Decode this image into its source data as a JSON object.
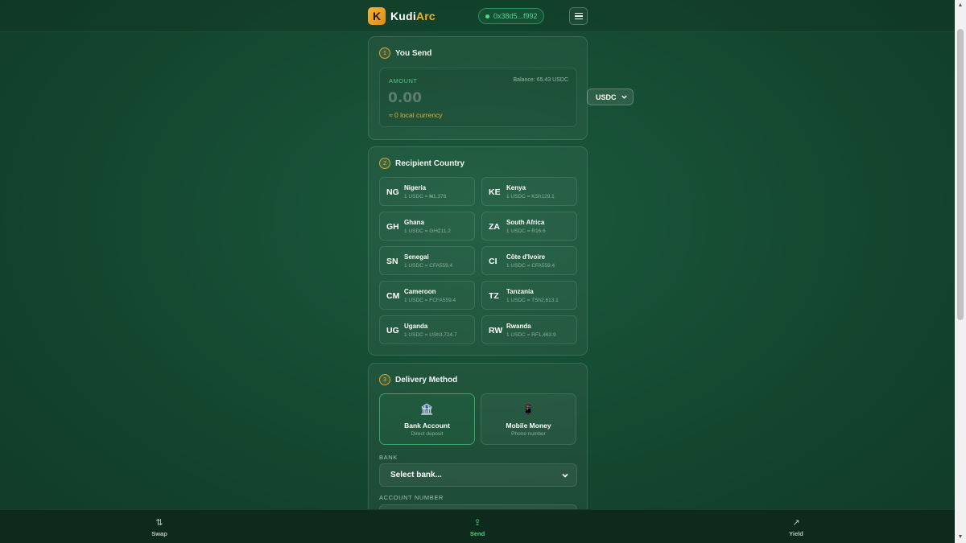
{
  "header": {
    "logo_letter": "K",
    "logo_text_a": "Kudi",
    "logo_text_b": "Arc",
    "wallet_address": "0x38d5...f992",
    "menu_icon": "hamburger-icon"
  },
  "send_section": {
    "step": "1",
    "title": "You Send",
    "amount_label": "AMOUNT",
    "balance": "Balance: 65.43 USDC",
    "amount_placeholder": "0.00",
    "local_estimate": "≈ 0 local currency",
    "currency": "USDC"
  },
  "country_section": {
    "step": "2",
    "title": "Recipient Country",
    "countries": [
      {
        "code": "NG",
        "name": "Nigeria",
        "rate": "1 USDC = ₦1,376"
      },
      {
        "code": "KE",
        "name": "Kenya",
        "rate": "1 USDC = KSh129.1"
      },
      {
        "code": "GH",
        "name": "Ghana",
        "rate": "1 USDC = GH₵11.2"
      },
      {
        "code": "ZA",
        "name": "South Africa",
        "rate": "1 USDC = R16.6"
      },
      {
        "code": "SN",
        "name": "Senegal",
        "rate": "1 USDC = CFA559.4"
      },
      {
        "code": "CI",
        "name": "Côte d'Ivoire",
        "rate": "1 USDC = CFA559.4"
      },
      {
        "code": "CM",
        "name": "Cameroon",
        "rate": "1 USDC = FCFA559.4"
      },
      {
        "code": "TZ",
        "name": "Tanzania",
        "rate": "1 USDC = TSh2,613.1"
      },
      {
        "code": "UG",
        "name": "Uganda",
        "rate": "1 USDC = USh3,724.7"
      },
      {
        "code": "RW",
        "name": "Rwanda",
        "rate": "1 USDC = RF1,463.9"
      }
    ]
  },
  "delivery_section": {
    "step": "3",
    "title": "Delivery Method",
    "methods": [
      {
        "name": "Bank Account",
        "sub": "Direct deposit",
        "icon": "bank-icon",
        "glyph": "🏦",
        "selected": true
      },
      {
        "name": "Mobile Money",
        "sub": "Phone number",
        "icon": "phone-icon",
        "glyph": "📱",
        "selected": false
      }
    ],
    "bank_label": "BANK",
    "bank_select_value": "Select bank...",
    "account_label": "ACCOUNT NUMBER"
  },
  "bottom_nav": [
    {
      "label": "Swap",
      "icon": "swap-icon",
      "glyph": "⇅",
      "active": false
    },
    {
      "label": "Send",
      "icon": "send-icon",
      "glyph": "⇪",
      "active": true
    },
    {
      "label": "Yield",
      "icon": "trend-up-icon",
      "glyph": "↗",
      "active": false
    }
  ],
  "colors": {
    "background": "#14472f",
    "accent_green": "#3fd584",
    "accent_gold": "#e7ac35"
  }
}
